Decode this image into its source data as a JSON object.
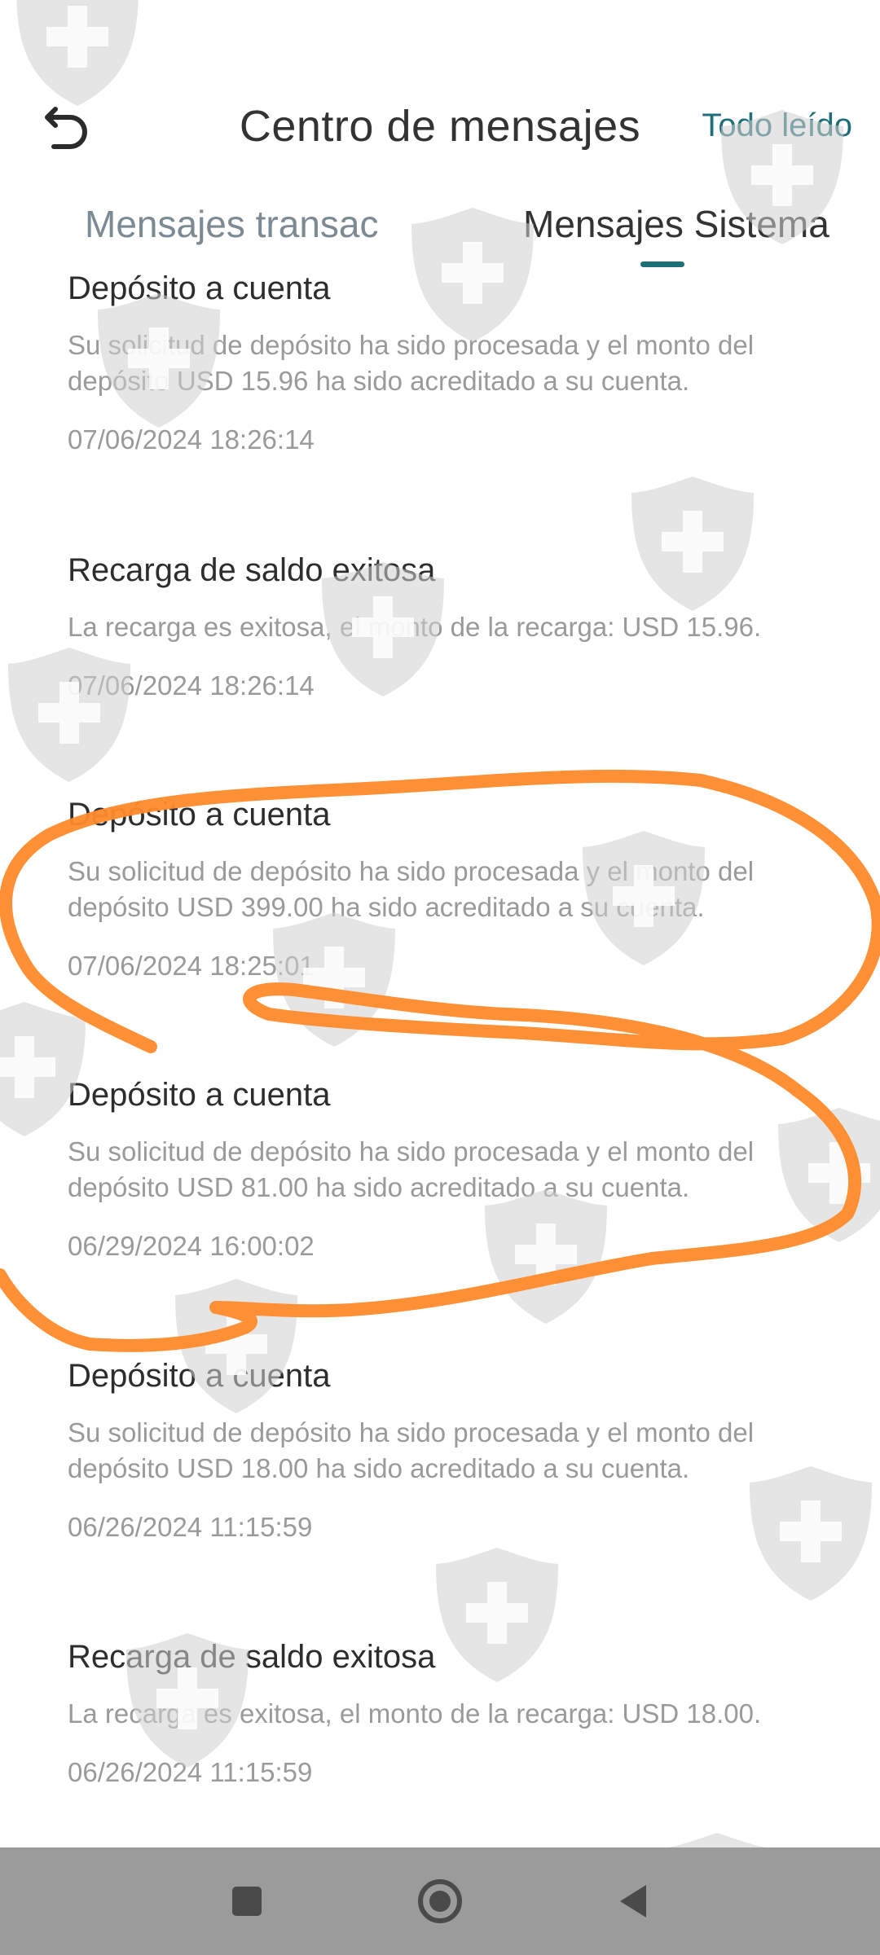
{
  "header": {
    "title": "Centro de mensajes",
    "mark_all_read": "Todo leído",
    "back_icon": "back-arrow-icon"
  },
  "tabs": [
    {
      "label": "Mensajes transac",
      "active": false
    },
    {
      "label": "Mensajes Sistema",
      "active": true
    }
  ],
  "messages": [
    {
      "title": "Depósito a cuenta",
      "body": "Su solicitud de depósito ha sido procesada y el monto del depósito USD 15.96 ha sido acreditado a su cuenta.",
      "date": "07/06/2024 18:26:14"
    },
    {
      "title": "Recarga de saldo exitosa",
      "body": "La recarga es exitosa, el monto de la recarga: USD 15.96.",
      "date": "07/06/2024 18:26:14"
    },
    {
      "title": "Depósito a cuenta",
      "body": "Su solicitud de depósito ha sido procesada y el monto del depósito USD 399.00 ha sido acreditado a su cuenta.",
      "date": "07/06/2024 18:25:01"
    },
    {
      "title": "Depósito a cuenta",
      "body": "Su solicitud de depósito ha sido procesada y el monto del depósito USD 81.00 ha sido acreditado a su cuenta.",
      "date": "06/29/2024 16:00:02"
    },
    {
      "title": "Depósito a cuenta",
      "body": "Su solicitud de depósito ha sido procesada y el monto del depósito USD 18.00 ha sido acreditado a su cuenta.",
      "date": "06/26/2024 11:15:59"
    },
    {
      "title": "Recarga de saldo exitosa",
      "body": "La recarga es exitosa, el monto de la recarga: USD 18.00.",
      "date": "06/26/2024 11:15:59"
    }
  ],
  "navbar": {
    "recents_icon": "square-recents-icon",
    "home_icon": "circle-home-icon",
    "back_icon": "triangle-back-icon"
  },
  "colors": {
    "accent": "#1f6f78",
    "annotation": "#ff8a2a",
    "watermark": "#d9d9d9",
    "navbar": "#9b9b9b"
  }
}
